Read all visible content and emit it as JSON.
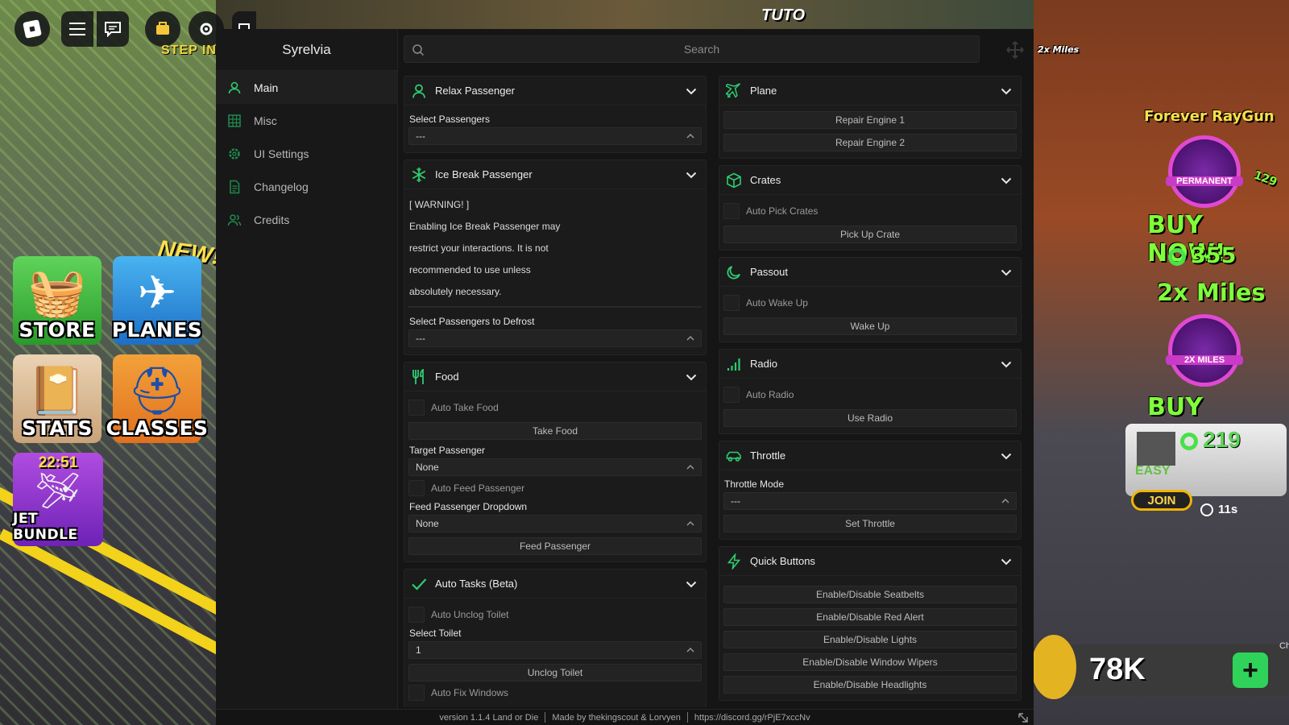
{
  "game": {
    "step_in": "STEP IN",
    "tutorial_sign": "TUTO",
    "new_badge": "NEW!",
    "tiles": {
      "store": "STORE",
      "planes": "PLANES",
      "stats": "STATS",
      "classes": "CLASSES",
      "jet_bundle": "JET BUNDLE",
      "jet_timer": "22:51"
    },
    "top_miles": "2x Miles",
    "ads": {
      "forever_raygun": "Forever RayGun",
      "permanent": "PERMANENT",
      "buy_now_1": "BUY NOW!",
      "price_1": "355",
      "miles_title": "2x Miles",
      "miles_badge": "2X MILES",
      "buy_now_2": "BUY NOW!",
      "side_count": "129"
    },
    "server_card": {
      "price": "219",
      "difficulty": "EASY",
      "join": "JOIN",
      "timer": "11s"
    },
    "money": {
      "value": "78K",
      "plus": "+"
    },
    "chat_label": "Ch"
  },
  "window": {
    "title": "Syrelvia",
    "search_placeholder": "Search",
    "nav": [
      {
        "label": "Main",
        "icon": "user-icon"
      },
      {
        "label": "Misc",
        "icon": "grid-icon"
      },
      {
        "label": "UI Settings",
        "icon": "gear-icon"
      },
      {
        "label": "Changelog",
        "icon": "document-icon"
      },
      {
        "label": "Credits",
        "icon": "users-icon"
      }
    ],
    "accent": "#2ecc71",
    "left": {
      "relax": {
        "title": "Relax Passenger",
        "select_label": "Select Passengers",
        "select_value": "---"
      },
      "ice": {
        "title": "Ice Break Passenger",
        "warning_lines": [
          "[ WARNING! ]",
          "Enabling Ice Break Passenger may",
          "restrict your interactions. It is not",
          "recommended to use unless",
          "absolutely necessary."
        ],
        "defrost_label": "Select Passengers to Defrost",
        "defrost_value": "---"
      },
      "food": {
        "title": "Food",
        "auto_take": "Auto Take Food",
        "take_button": "Take Food",
        "target_label": "Target Passenger",
        "target_value": "None",
        "auto_feed": "Auto Feed Passenger",
        "feed_dropdown_label": "Feed Passenger Dropdown",
        "feed_dropdown_value": "None",
        "feed_button": "Feed Passenger"
      },
      "tasks": {
        "title": "Auto Tasks (Beta)",
        "auto_unclog": "Auto Unclog Toilet",
        "toilet_label": "Select Toilet",
        "toilet_value": "1",
        "unclog_button": "Unclog Toilet",
        "auto_fix": "Auto Fix Windows"
      }
    },
    "right": {
      "plane": {
        "title": "Plane",
        "repair1": "Repair Engine 1",
        "repair2": "Repair Engine 2"
      },
      "crates": {
        "title": "Crates",
        "auto_pick": "Auto Pick Crates",
        "pickup_button": "Pick Up Crate"
      },
      "passout": {
        "title": "Passout",
        "auto_wake": "Auto Wake Up",
        "wake_button": "Wake Up"
      },
      "radio": {
        "title": "Radio",
        "auto_radio": "Auto Radio",
        "use_button": "Use Radio"
      },
      "throttle": {
        "title": "Throttle",
        "mode_label": "Throttle Mode",
        "mode_value": "---",
        "set_button": "Set Throttle"
      },
      "quick": {
        "title": "Quick Buttons",
        "buttons": [
          "Enable/Disable Seatbelts",
          "Enable/Disable Red Alert",
          "Enable/Disable Lights",
          "Enable/Disable Window Wipers",
          "Enable/Disable Headlights"
        ]
      }
    },
    "footer": {
      "version": "version 1.1.4 Land or Die",
      "credits": "Made by thekingscout & Lorvyen",
      "discord": "https://discord.gg/rPjE7xccNv"
    }
  }
}
